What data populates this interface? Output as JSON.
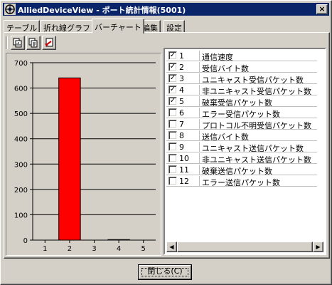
{
  "window": {
    "title": "AlliedDeviceView - ポート統計情報(5001)",
    "close_glyph": "×"
  },
  "tabs": [
    {
      "label": "テーブル",
      "active": false
    },
    {
      "label": "折れ線グラフ",
      "active": false
    },
    {
      "label": "バーチャート",
      "active": true
    },
    {
      "label": "編集",
      "active": false
    },
    {
      "label": "設定",
      "active": false
    }
  ],
  "toolbar": {
    "icons": [
      "copy-chart-icon",
      "copy-data-icon",
      "export-icon"
    ]
  },
  "chart_data": {
    "type": "bar",
    "categories": [
      "1",
      "2",
      "3",
      "4",
      "5"
    ],
    "values": [
      0,
      640,
      0,
      2,
      0
    ],
    "ylim": [
      0,
      700
    ],
    "yticks": [
      "0",
      "100",
      "200",
      "300",
      "400",
      "500",
      "600",
      "700"
    ],
    "grid": true,
    "bar_color": "#ff0000"
  },
  "counters": [
    {
      "num": "1",
      "label": "通信速度",
      "checked": true
    },
    {
      "num": "2",
      "label": "受信バイト数",
      "checked": true
    },
    {
      "num": "3",
      "label": "ユニキャスト受信パケット数",
      "checked": true
    },
    {
      "num": "4",
      "label": "非ユニキャスト受信パケット数",
      "checked": true
    },
    {
      "num": "5",
      "label": "破棄受信パケット数",
      "checked": true
    },
    {
      "num": "6",
      "label": "エラー受信パケット数",
      "checked": false
    },
    {
      "num": "7",
      "label": "プロトコル不明受信パケット数",
      "checked": false
    },
    {
      "num": "8",
      "label": "送信バイト数",
      "checked": false
    },
    {
      "num": "9",
      "label": "ユニキャスト送信パケット数",
      "checked": false
    },
    {
      "num": "10",
      "label": "非ユニキャスト送信パケット数",
      "checked": false
    },
    {
      "num": "11",
      "label": "破棄送信パケット数",
      "checked": false
    },
    {
      "num": "12",
      "label": "エラー送信パケット数",
      "checked": false
    }
  ],
  "footer": {
    "close_label": "閉じる(C)"
  }
}
